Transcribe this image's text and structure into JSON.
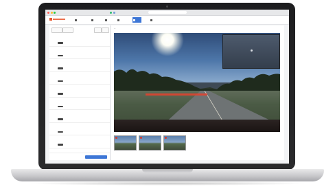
{
  "browser": {
    "url": "",
    "dot_colors": [
      "#ff5f57",
      "#febc2e",
      "#28c840"
    ]
  },
  "app": {
    "logo_text": "",
    "accent_color": "#3d76d6",
    "brand_color": "#e8572f",
    "nav": [
      {
        "label": "",
        "icon": "home-icon"
      },
      {
        "label": "",
        "icon": "list-icon"
      },
      {
        "label": "",
        "icon": "truck-icon"
      },
      {
        "label": "",
        "icon": "report-icon"
      },
      {
        "label": "",
        "icon": "video-icon",
        "active": true
      },
      {
        "label": "",
        "icon": "map-icon"
      }
    ]
  },
  "events_panel": {
    "items": [
      {
        "date": "",
        "id": "",
        "sub": ""
      },
      {
        "date": "",
        "id": "",
        "sub": ""
      },
      {
        "date": "",
        "id": "",
        "sub": ""
      },
      {
        "date": "",
        "id": "",
        "sub": ""
      },
      {
        "date": "",
        "id": "",
        "sub": ""
      },
      {
        "date": "",
        "id": "",
        "sub": ""
      },
      {
        "date": "",
        "id": "",
        "sub": ""
      },
      {
        "date": "",
        "id": "",
        "sub": ""
      },
      {
        "date": "",
        "id": "",
        "sub": ""
      }
    ],
    "footer": {
      "secondary_label": "",
      "primary_label": ""
    }
  },
  "viewer": {
    "title": "",
    "subtitle": "",
    "link_label": "",
    "overlay_left": "",
    "overlay_right": "",
    "thumbnails": [
      {
        "caption": ""
      },
      {
        "caption": ""
      },
      {
        "caption": ""
      }
    ]
  }
}
